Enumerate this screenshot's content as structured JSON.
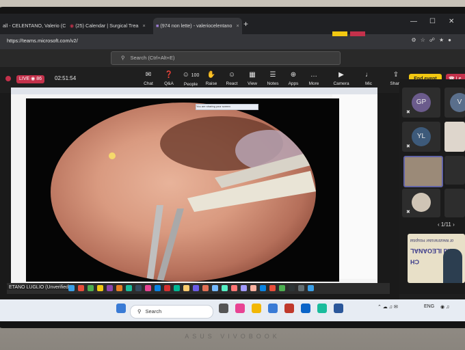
{
  "browser": {
    "tabs": [
      {
        "label": "all - CELENTANO, Valerio (CH",
        "close": "×"
      },
      {
        "label": "(25) Calendar | Surgical Trea",
        "close": "×"
      },
      {
        "label": "(974 non lette) - valeriocelentano",
        "close": "×"
      }
    ],
    "new_tab": "+",
    "url": "https://teams.microsoft.com/v2/"
  },
  "teams": {
    "search_placeholder": "Search (Ctrl+Alt+E)",
    "live_label": "LIVE",
    "viewers": "86",
    "timer": "02:51:54",
    "toolbar": [
      {
        "label": "Chat",
        "icon": "chat-icon",
        "glyph": "✉"
      },
      {
        "label": "Q&A",
        "icon": "qa-icon",
        "glyph": "❓"
      },
      {
        "label": "People",
        "icon": "people-icon",
        "glyph": "☺",
        "badge": "100"
      },
      {
        "label": "Raise",
        "icon": "raise-hand-icon",
        "glyph": "✋"
      },
      {
        "label": "React",
        "icon": "react-icon",
        "glyph": "☺"
      },
      {
        "label": "View",
        "icon": "view-icon",
        "glyph": "▦"
      },
      {
        "label": "Notes",
        "icon": "notes-icon",
        "glyph": "☰"
      },
      {
        "label": "Apps",
        "icon": "apps-icon",
        "glyph": "⊕"
      },
      {
        "label": "More",
        "icon": "more-icon",
        "glyph": "…"
      },
      {
        "label": "Camera",
        "icon": "camera-icon",
        "glyph": "▶"
      },
      {
        "label": "Mic",
        "icon": "mic-icon",
        "glyph": "♩"
      },
      {
        "label": "Share",
        "icon": "share-icon",
        "glyph": "⇪"
      }
    ],
    "end_event": "End event",
    "leave": "Le",
    "participants": [
      {
        "initials": "GP",
        "color": "#6b5b8c"
      },
      {
        "initials": "V",
        "color": "#5a6f8c"
      },
      {
        "initials": "YL",
        "color": "#3d5a7a"
      }
    ],
    "pager": "1/11",
    "slide_text": [
      "of Westminster Hospital",
      "and ILEOANAL",
      "CH"
    ],
    "shared_user": "ETANO LUGLIO (Unverified)",
    "shared_banner": "You are sharing your screen"
  },
  "taskbar": {
    "search": "Search",
    "lang": "ENG"
  },
  "laptop_brand": "ASUS VIVOBOOK"
}
